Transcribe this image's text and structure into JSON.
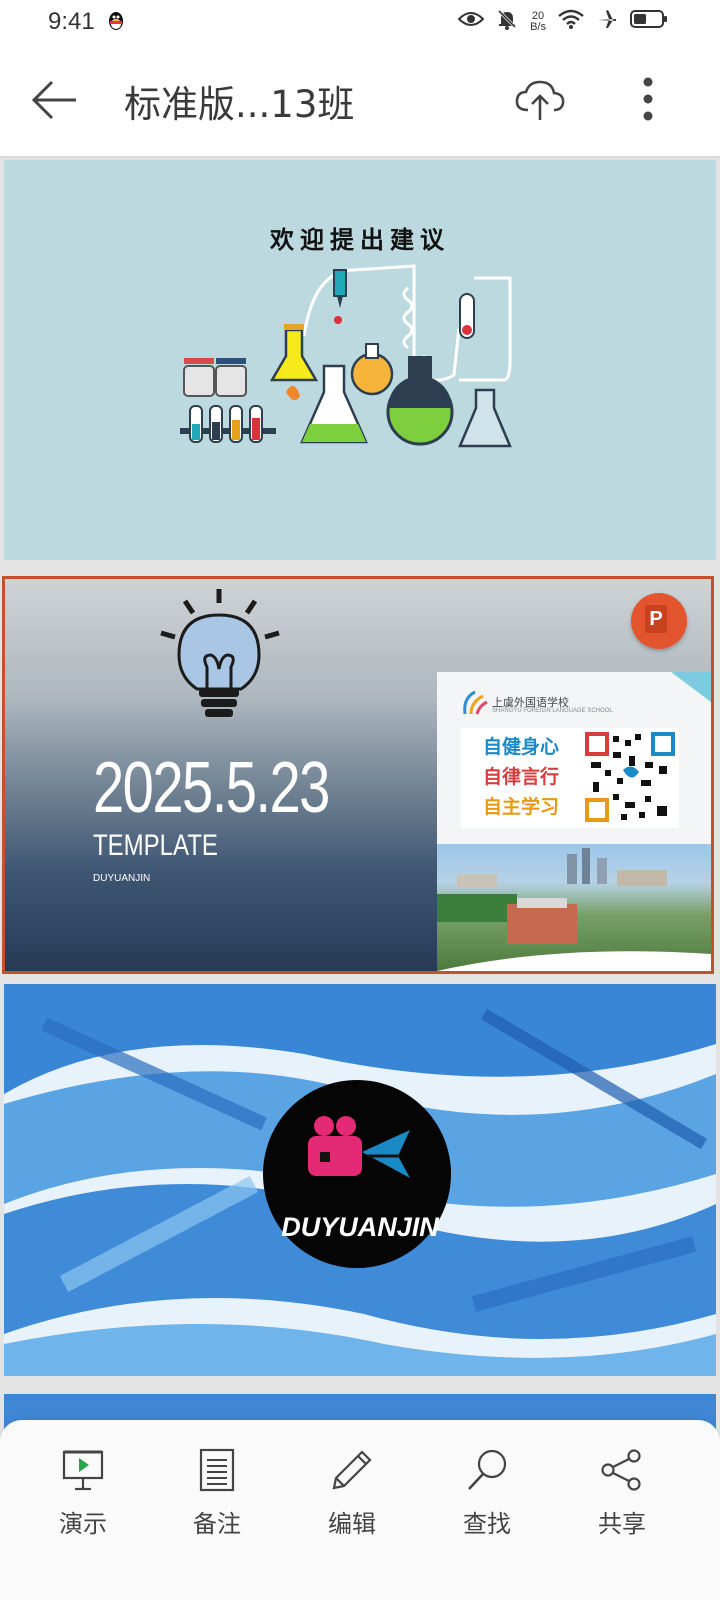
{
  "status_bar": {
    "time": "9:41",
    "net_speed_value": "20",
    "net_speed_unit": "B/s"
  },
  "header": {
    "title": "标准版...13班"
  },
  "slides": [
    {
      "title": "欢迎提出建议"
    },
    {
      "date": "2025.5.23",
      "template": "TEMPLATE",
      "brand": "DUYUANJIN",
      "app_badge": "P",
      "school_name": "上虞外国语学校",
      "school_name_en": "SHANGYU FOREIGN LANGUAGE SCHOOL",
      "motto": [
        "自健身心",
        "自律言行",
        "自主学习"
      ]
    },
    {
      "brand": "DUYUANJIN"
    }
  ],
  "toolbar": {
    "items": [
      {
        "label": "演示",
        "icon": "presentation-icon"
      },
      {
        "label": "备注",
        "icon": "notes-icon"
      },
      {
        "label": "编辑",
        "icon": "pencil-icon"
      },
      {
        "label": "查找",
        "icon": "search-icon"
      },
      {
        "label": "共享",
        "icon": "share-icon"
      }
    ]
  },
  "colors": {
    "selection_border": "#c2532e",
    "powerpoint": "#e2552e",
    "slide1_bg": "#bcd9df",
    "brush_blue": "#3a86d6"
  }
}
